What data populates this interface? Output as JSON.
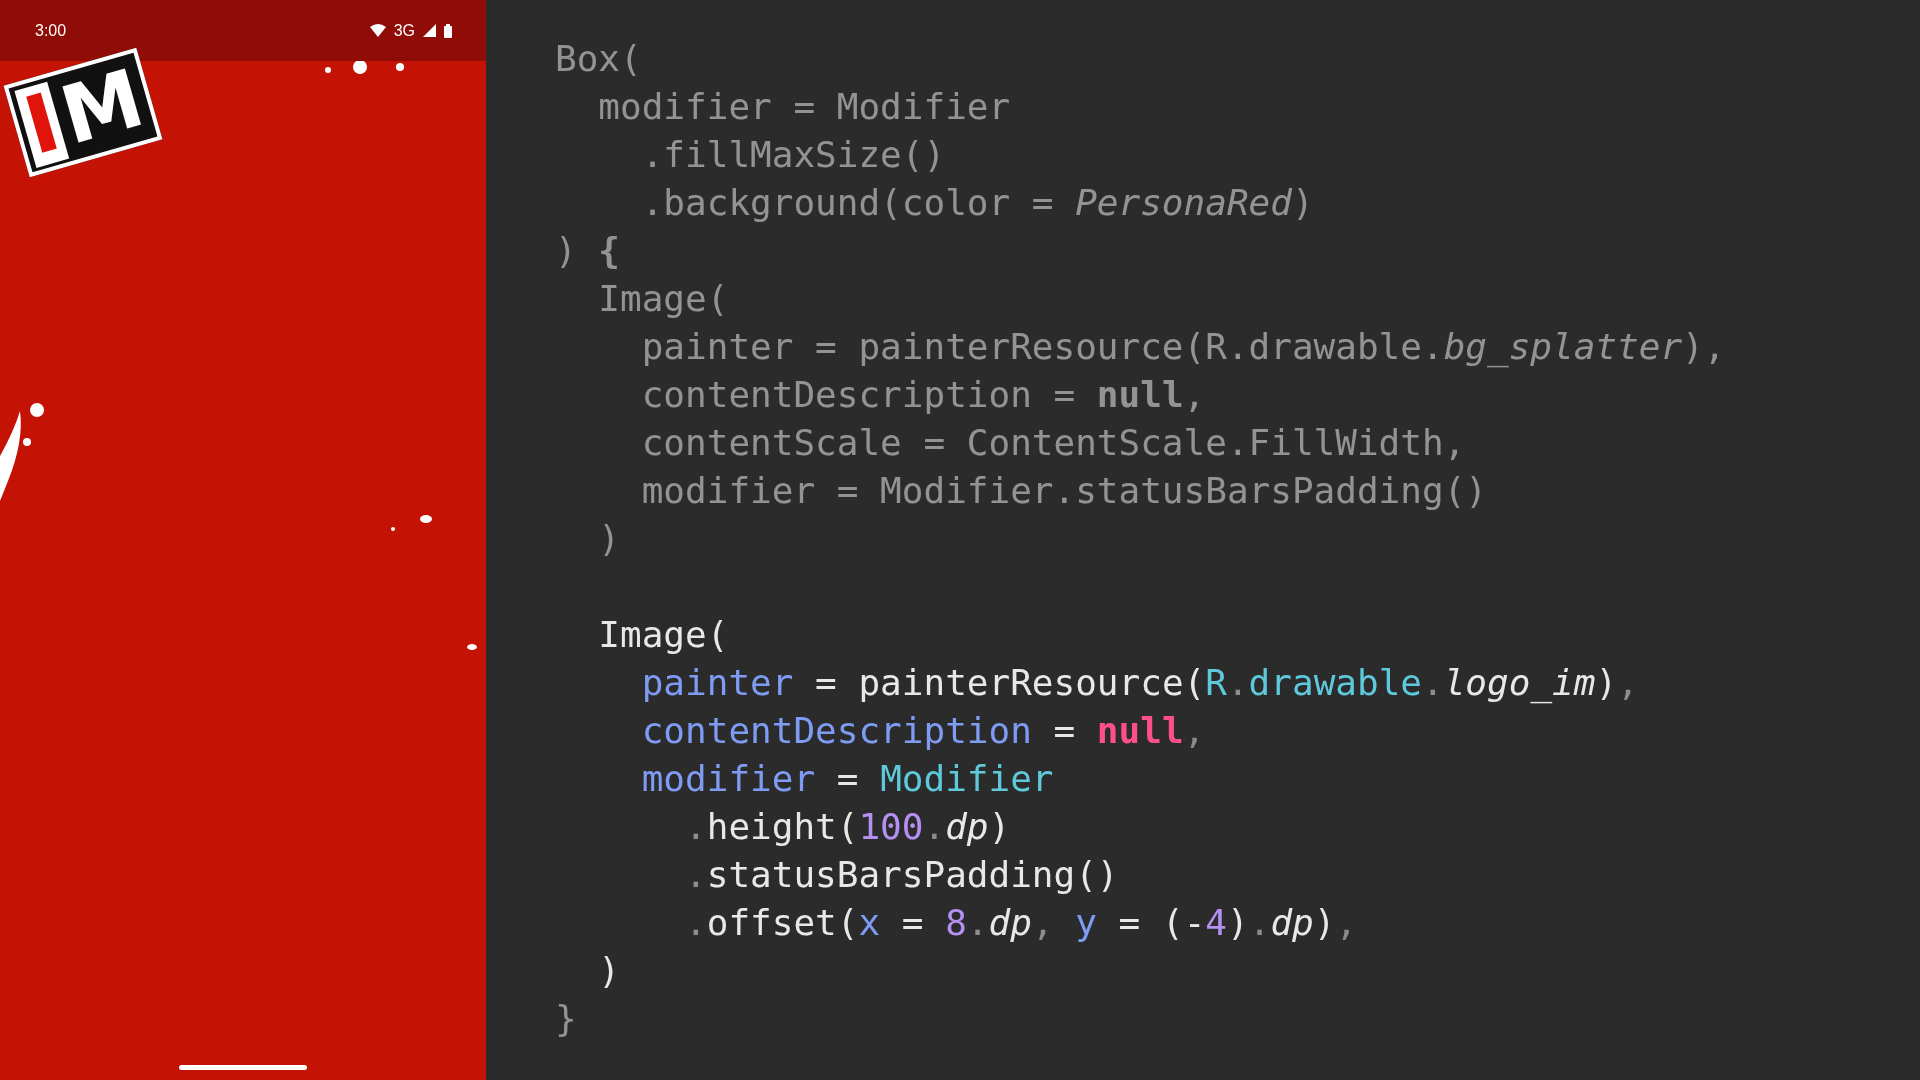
{
  "phone": {
    "status_bar": {
      "time": "3:00",
      "network": "3G"
    },
    "logo": {
      "letters": [
        "I",
        "M"
      ]
    }
  },
  "code": {
    "lines": [
      {
        "kind": "code",
        "dimmed": true,
        "tokens": [
          {
            "text": "Box(",
            "kind": "plain"
          }
        ]
      },
      {
        "kind": "code",
        "dimmed": true,
        "tokens": [
          {
            "text": "  modifier = Modifier",
            "kind": "plain"
          }
        ]
      },
      {
        "kind": "code",
        "dimmed": true,
        "tokens": [
          {
            "text": "    .fillMaxSize()",
            "kind": "plain"
          }
        ]
      },
      {
        "kind": "code",
        "dimmed": true,
        "tokens": [
          {
            "text": "    .background(color = ",
            "kind": "plain"
          },
          {
            "text": "PersonaRed",
            "kind": "italic"
          },
          {
            "text": ")",
            "kind": "plain"
          }
        ]
      },
      {
        "kind": "code",
        "dimmed": true,
        "tokens": [
          {
            "text": ") ",
            "kind": "plain"
          },
          {
            "text": "{",
            "kind": "bold"
          }
        ]
      },
      {
        "kind": "code",
        "dimmed": true,
        "tokens": [
          {
            "text": "  Image(",
            "kind": "plain"
          }
        ]
      },
      {
        "kind": "code",
        "dimmed": true,
        "tokens": [
          {
            "text": "    painter = painterResource(R.drawable.",
            "kind": "plain"
          },
          {
            "text": "bg_splatter",
            "kind": "italic"
          },
          {
            "text": "),",
            "kind": "plain"
          }
        ]
      },
      {
        "kind": "code",
        "dimmed": true,
        "tokens": [
          {
            "text": "    contentDescription = ",
            "kind": "plain"
          },
          {
            "text": "null",
            "kind": "bold"
          },
          {
            "text": ",",
            "kind": "plain"
          }
        ]
      },
      {
        "kind": "code",
        "dimmed": true,
        "tokens": [
          {
            "text": "    contentScale = ContentScale.FillWidth,",
            "kind": "plain"
          }
        ]
      },
      {
        "kind": "code",
        "dimmed": true,
        "tokens": [
          {
            "text": "    modifier = Modifier.statusBarsPadding()",
            "kind": "plain"
          }
        ]
      },
      {
        "kind": "code",
        "dimmed": true,
        "tokens": [
          {
            "text": "  )",
            "kind": "plain"
          }
        ]
      },
      {
        "kind": "blank"
      },
      {
        "kind": "code",
        "dimmed": false,
        "tokens": [
          {
            "text": "  Image(",
            "kind": "plain"
          }
        ]
      },
      {
        "kind": "code",
        "dimmed": false,
        "tokens": [
          {
            "text": "    painter",
            "kind": "property"
          },
          {
            "text": " = painterResource(",
            "kind": "plain"
          },
          {
            "text": "R",
            "kind": "class"
          },
          {
            "text": ".",
            "kind": "punct"
          },
          {
            "text": "drawable",
            "kind": "class"
          },
          {
            "text": ".",
            "kind": "punct"
          },
          {
            "text": "logo_im",
            "kind": "italic"
          },
          {
            "text": ")",
            "kind": "plain"
          },
          {
            "text": ",",
            "kind": "punct"
          }
        ]
      },
      {
        "kind": "code",
        "dimmed": false,
        "tokens": [
          {
            "text": "    contentDescription",
            "kind": "property"
          },
          {
            "text": " = ",
            "kind": "plain"
          },
          {
            "text": "null",
            "kind": "keyword"
          },
          {
            "text": ",",
            "kind": "punct"
          }
        ]
      },
      {
        "kind": "code",
        "dimmed": false,
        "tokens": [
          {
            "text": "    modifier",
            "kind": "property"
          },
          {
            "text": " = ",
            "kind": "plain"
          },
          {
            "text": "Modifier",
            "kind": "class"
          }
        ]
      },
      {
        "kind": "code",
        "dimmed": false,
        "tokens": [
          {
            "text": "      .",
            "kind": "punct"
          },
          {
            "text": "height(",
            "kind": "plain"
          },
          {
            "text": "100",
            "kind": "number"
          },
          {
            "text": ".",
            "kind": "punct"
          },
          {
            "text": "dp",
            "kind": "italic"
          },
          {
            "text": ")",
            "kind": "plain"
          }
        ]
      },
      {
        "kind": "code",
        "dimmed": false,
        "tokens": [
          {
            "text": "      .",
            "kind": "punct"
          },
          {
            "text": "statusBarsPadding()",
            "kind": "plain"
          }
        ]
      },
      {
        "kind": "code",
        "dimmed": false,
        "tokens": [
          {
            "text": "      .",
            "kind": "punct"
          },
          {
            "text": "offset(",
            "kind": "plain"
          },
          {
            "text": "x",
            "kind": "property"
          },
          {
            "text": " = ",
            "kind": "plain"
          },
          {
            "text": "8",
            "kind": "number"
          },
          {
            "text": ".",
            "kind": "punct"
          },
          {
            "text": "dp",
            "kind": "italic"
          },
          {
            "text": ", ",
            "kind": "punct"
          },
          {
            "text": "y",
            "kind": "property"
          },
          {
            "text": " = (-",
            "kind": "plain"
          },
          {
            "text": "4",
            "kind": "number"
          },
          {
            "text": ")",
            "kind": "plain"
          },
          {
            "text": ".",
            "kind": "punct"
          },
          {
            "text": "dp",
            "kind": "italic"
          },
          {
            "text": ")",
            "kind": "plain"
          },
          {
            "text": ",",
            "kind": "punct"
          }
        ]
      },
      {
        "kind": "code",
        "dimmed": false,
        "tokens": [
          {
            "text": "  )",
            "kind": "plain"
          }
        ]
      },
      {
        "kind": "code",
        "dimmed": true,
        "tokens": [
          {
            "text": "}",
            "kind": "plain"
          }
        ]
      }
    ]
  }
}
